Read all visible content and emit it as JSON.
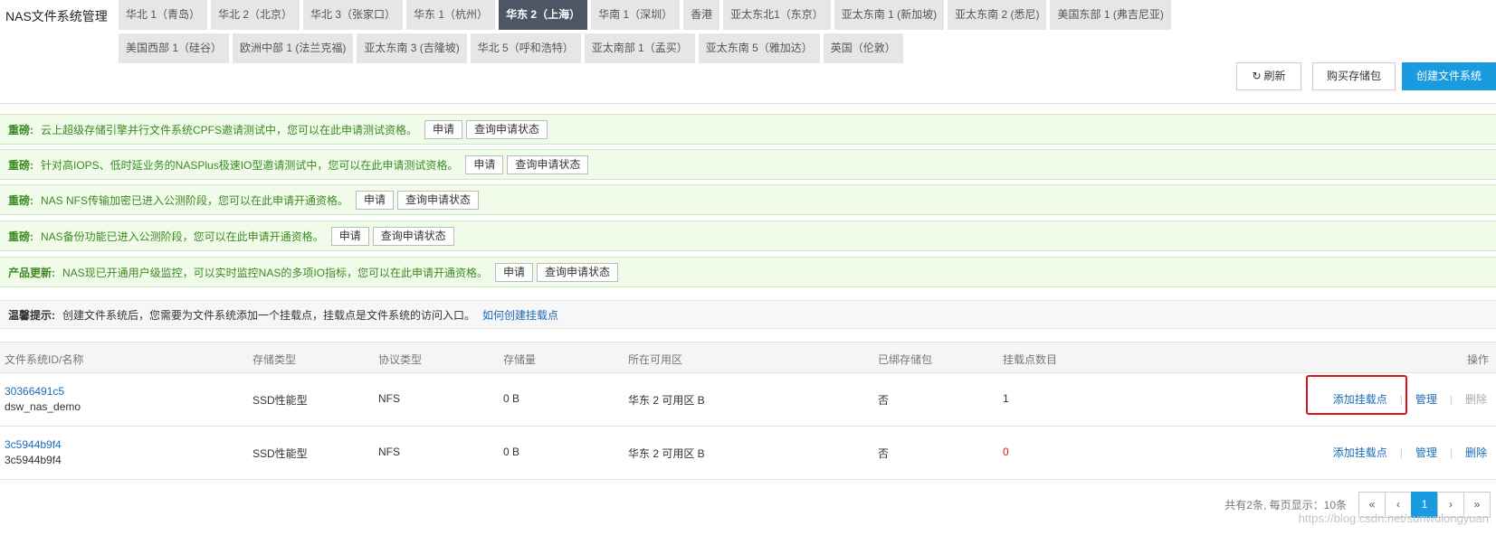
{
  "app": {
    "title": "NAS文件系统管理"
  },
  "regions": [
    "华北 1（青岛）",
    "华北 2（北京）",
    "华北 3（张家口）",
    "华东 1（杭州）",
    "华东 2（上海）",
    "华南 1（深圳）",
    "香港",
    "亚太东北1（东京）",
    "亚太东南 1 (新加坡)",
    "亚太东南 2 (悉尼)",
    "美国东部 1 (弗吉尼亚)",
    "美国西部 1（硅谷）",
    "欧洲中部 1 (法兰克福)",
    "亚太东南 3 (吉隆坡)",
    "华北 5（呼和浩特）",
    "亚太南部 1（孟买）",
    "亚太东南 5（雅加达）",
    "英国（伦敦）"
  ],
  "active_region": "华东 2（上海）",
  "toolbar": {
    "refresh": "刷新",
    "buy": "购买存储包",
    "create": "创建文件系统"
  },
  "notices": [
    {
      "tag": "重磅:",
      "msg": "云上超级存储引擎并行文件系统CPFS邀请测试中，您可以在此申请测试资格。",
      "apply": "申请",
      "query": "查询申请状态"
    },
    {
      "tag": "重磅:",
      "msg": "针对高IOPS、低时延业务的NASPlus极速IO型邀请测试中，您可以在此申请测试资格。",
      "apply": "申请",
      "query": "查询申请状态"
    },
    {
      "tag": "重磅:",
      "msg": "NAS NFS传输加密已进入公测阶段，您可以在此申请开通资格。",
      "apply": "申请",
      "query": "查询申请状态"
    },
    {
      "tag": "重磅:",
      "msg": "NAS备份功能已进入公测阶段，您可以在此申请开通资格。",
      "apply": "申请",
      "query": "查询申请状态"
    },
    {
      "tag": "产品更新:",
      "msg": "NAS现已开通用户级监控，可以实时监控NAS的多项IO指标，您可以在此申请开通资格。",
      "apply": "申请",
      "query": "查询申请状态"
    }
  ],
  "tip": {
    "tag": "温馨提示:",
    "msg": "创建文件系统后，您需要为文件系统添加一个挂载点，挂载点是文件系统的访问入口。",
    "link": "如何创建挂载点"
  },
  "table": {
    "headers": {
      "id": "文件系统ID/名称",
      "storage": "存储类型",
      "protocol": "协议类型",
      "capacity": "存储量",
      "zone": "所在可用区",
      "package": "已绑存储包",
      "mounts": "挂载点数目",
      "ops": "操作"
    },
    "rows": [
      {
        "id": "30366491c5",
        "name": "dsw_nas_demo",
        "storage": "SSD性能型",
        "protocol": "NFS",
        "capacity": "0 B",
        "zone": "华东 2 可用区 B",
        "package": "否",
        "mounts": "1",
        "add": "添加挂载点",
        "manage": "管理",
        "delete": "删除"
      },
      {
        "id": "3c5944b9f4",
        "name": "3c5944b9f4",
        "storage": "SSD性能型",
        "protocol": "NFS",
        "capacity": "0 B",
        "zone": "华东 2 可用区 B",
        "package": "否",
        "mounts": "0",
        "add": "添加挂载点",
        "manage": "管理",
        "delete": "删除"
      }
    ]
  },
  "pager": {
    "summary": "共有2条, 每页显示：10条",
    "first": "«",
    "prev": "‹",
    "page": "1",
    "next": "›",
    "last": "»"
  },
  "watermark": "https://blog.csdn.net/sunwulongyuan",
  "colors": {
    "accent": "#1a9be0",
    "notice_green": "#3c8a22",
    "link": "#1a6bb8",
    "zero_red": "#d9141e"
  }
}
